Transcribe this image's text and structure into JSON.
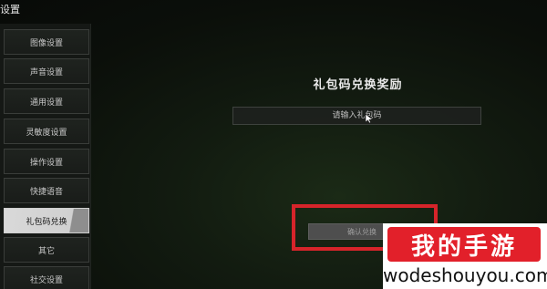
{
  "window": {
    "title": "设置"
  },
  "sidebar": {
    "items": [
      {
        "label": "图像设置"
      },
      {
        "label": "声音设置"
      },
      {
        "label": "通用设置"
      },
      {
        "label": "灵敏度设置"
      },
      {
        "label": "操作设置"
      },
      {
        "label": "快捷语音"
      },
      {
        "label": "礼包码兑换",
        "active": true
      },
      {
        "label": "其它"
      },
      {
        "label": "社交设置"
      }
    ]
  },
  "main": {
    "title": "礼包码兑换奖励",
    "code_input": {
      "placeholder": "请输入礼包码",
      "value": ""
    },
    "redeem_button": {
      "label": "确认兑换"
    },
    "highlight_color": "#d6242a"
  },
  "watermark": {
    "brand": "我的手游",
    "url": "wodeshouyou.com",
    "badge_color": "#e2202a"
  }
}
